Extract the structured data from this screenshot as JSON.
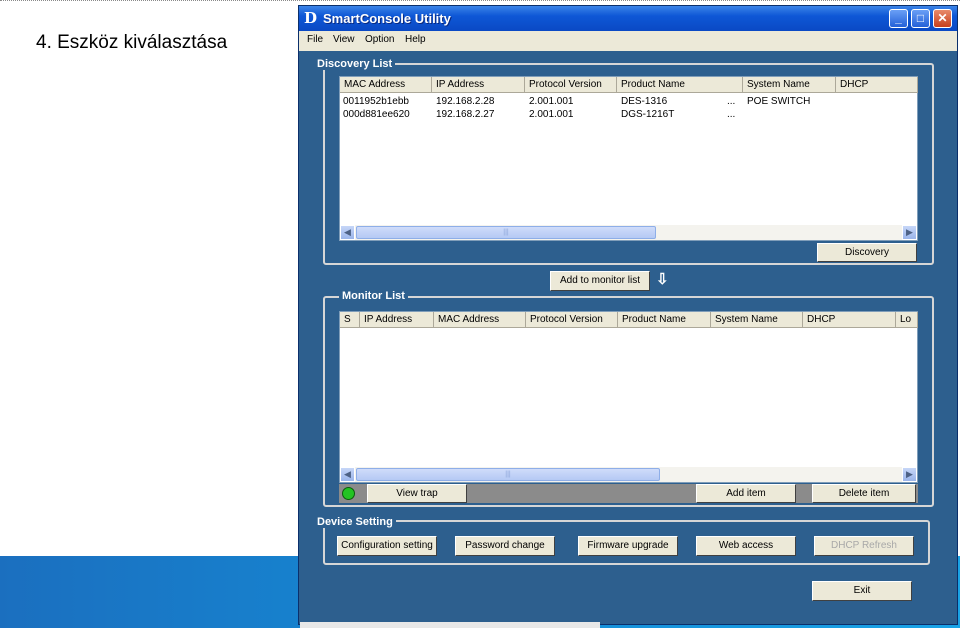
{
  "slide": {
    "title": "4. Eszköz kiválasztása",
    "band_color": "#1589d4"
  },
  "window": {
    "title": "SmartConsole Utility",
    "icon_letter": "D",
    "controls": {
      "minimize": "_",
      "maximize": "□",
      "close": "✕"
    }
  },
  "menu": [
    "File",
    "View",
    "Option",
    "Help"
  ],
  "discovery": {
    "label": "Discovery List",
    "columns": [
      "MAC Address",
      "IP Address",
      "Protocol Version",
      "Product Name",
      "System Name",
      "DHCP"
    ],
    "rows": [
      {
        "mac": "0011952b1ebb",
        "ip": "192.168.2.28",
        "protocol": "2.001.001",
        "product": "DES-1316",
        "ellipsis": "...",
        "system": "POE SWITCH"
      },
      {
        "mac": "000d881ee620",
        "ip": "192.168.2.27",
        "protocol": "2.001.001",
        "product": "DGS-1216T",
        "ellipsis": "...",
        "system": ""
      }
    ],
    "button": "Discovery"
  },
  "add_to_monitor": "Add to monitor list",
  "monitor": {
    "label": "Monitor List",
    "columns": [
      "S",
      "IP Address",
      "MAC Address",
      "Protocol Version",
      "Product Name",
      "System Name",
      "DHCP",
      "Lo"
    ],
    "view_trap": "View trap",
    "add_item": "Add item",
    "delete_item": "Delete item"
  },
  "device_setting": {
    "label": "Device Setting",
    "buttons": [
      "Configuration setting",
      "Password change",
      "Firmware upgrade",
      "Web access",
      "DHCP Refresh"
    ]
  },
  "exit": "Exit",
  "colors": {
    "window_bg": "#2d5f8e",
    "titlebar": "#0e57d6",
    "status_led": "#22c322"
  }
}
